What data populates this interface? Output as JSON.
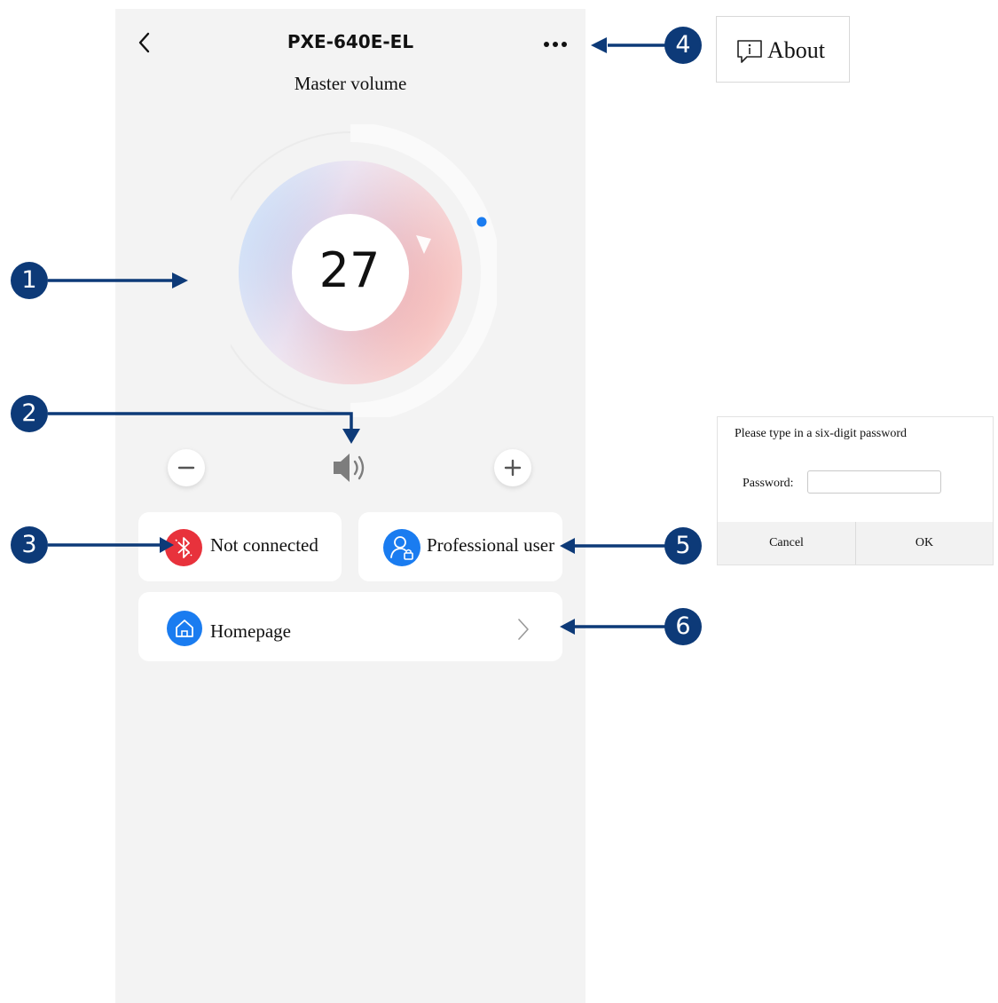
{
  "header": {
    "title": "PXE-640E-EL",
    "subtitle": "Master volume"
  },
  "volume": {
    "value": "27"
  },
  "cards": {
    "bluetooth_label": "Not connected",
    "user_label": "Professional user",
    "homepage_label": "Homepage"
  },
  "about_menu": {
    "label": "About"
  },
  "password_dialog": {
    "title": "Please type in a six-digit password",
    "field_label": "Password:",
    "field_value": "",
    "cancel_label": "Cancel",
    "ok_label": "OK"
  },
  "markers": [
    "1",
    "2",
    "3",
    "4",
    "5",
    "6"
  ],
  "icons": {
    "back": "chevron-left-icon",
    "more": "more-dots-icon",
    "minus": "minus-icon",
    "plus": "plus-icon",
    "speaker": "speaker-icon",
    "bluetooth": "bluetooth-off-icon",
    "user": "user-lock-icon",
    "home": "home-icon",
    "chevron": "chevron-right-icon",
    "about": "info-comment-icon"
  },
  "colors": {
    "annotation": "#0d3a78",
    "bluetooth_red": "#e8323c",
    "accent_blue": "#1a7cf0",
    "phone_bg": "#f3f3f3"
  }
}
